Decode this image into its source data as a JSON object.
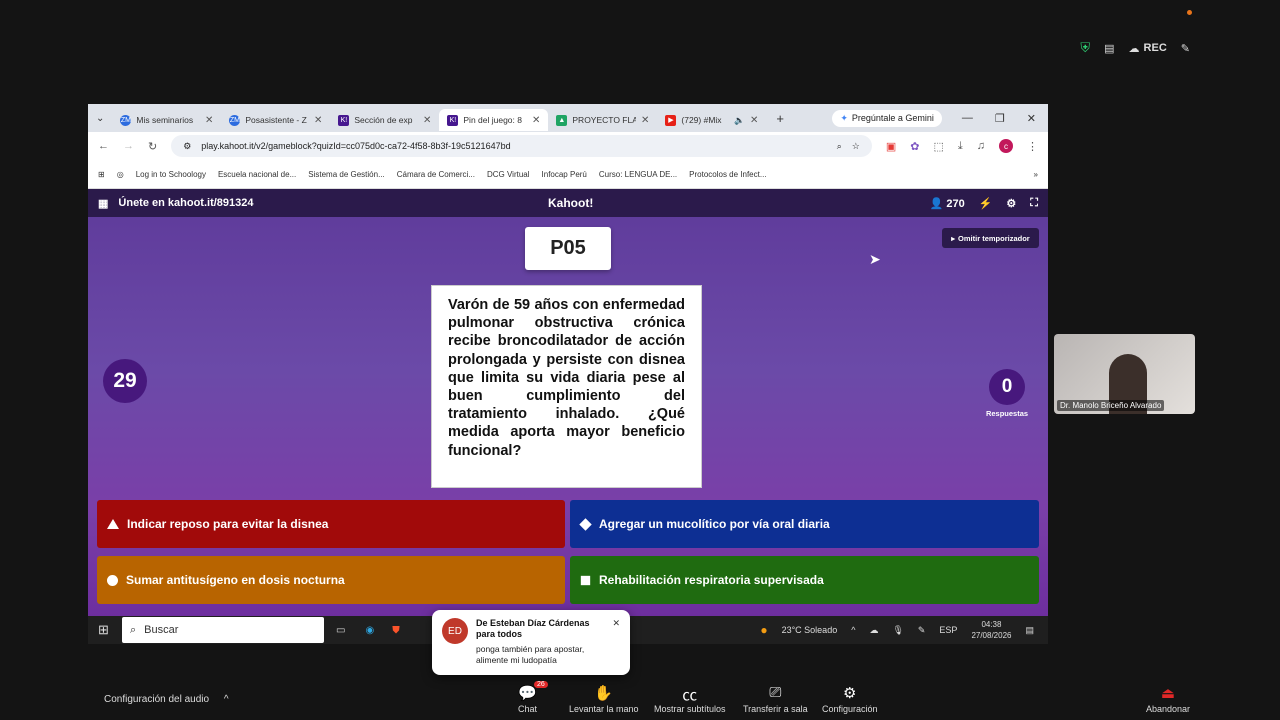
{
  "zoom": {
    "rec_label": "REC",
    "audio_config": "Configuración del audio",
    "footer": {
      "chat": "Chat",
      "chat_badge": "26",
      "raise_hand": "Levantar la mano",
      "captions": "Mostrar subtítulos",
      "transfer": "Transferir a sala",
      "settings": "Configuración",
      "leave": "Abandonar"
    },
    "video_name": "Dr. Manolo Briceño Alvarado",
    "chat_popup": {
      "avatar": "ED",
      "from": "De Esteban Díaz Cárdenas para todos",
      "message": "ponga también para apostar, alimente mi ludopatía"
    }
  },
  "browser": {
    "tabs": [
      {
        "title": "Mis seminarios",
        "fav": "ZM",
        "color": "#2d6cdf"
      },
      {
        "title": "Posasistente - Z",
        "fav": "ZM",
        "color": "#2d6cdf"
      },
      {
        "title": "Sección de exp",
        "fav": "K!",
        "color": "#46178f"
      },
      {
        "title": "Pin del juego: 8",
        "fav": "K!",
        "color": "#46178f"
      },
      {
        "title": "PROYECTO FLA",
        "fav": "▲",
        "color": "#1fa463"
      },
      {
        "title": "(729) #Mix",
        "fav": "▶",
        "color": "#e62117"
      }
    ],
    "gemini": "Pregúntale a Gemini",
    "url": "play.kahoot.it/v2/gameblock?quizId=cc075d0c-ca72-4f58-8b3f-19c5121647bd",
    "bookmarks": [
      "Log in to Schoology",
      "Escuela nacional de...",
      "Sistema de Gestión...",
      "Cámara de Comerci...",
      "DCG Virtual",
      "Infocap Perú",
      "Curso: LENGUA DE...",
      "Protocolos de Infect..."
    ]
  },
  "kahoot": {
    "join": "Únete en kahoot.it/891324",
    "logo": "Kahoot!",
    "players": "270",
    "pin_label": "P05",
    "skip": "Omitir temporizador",
    "timer": "29",
    "answers_count": "0",
    "answers_label": "Respuestas",
    "question": "Varón de 59 años con enfermedad pulmonar obstructiva crónica recibe broncodilatador de acción prolongada y persiste con disnea que limita su vida diaria pese al buen cumplimiento del tratamiento inhalado. ¿Qué medida aporta mayor beneficio funcional?",
    "answers": [
      {
        "text": "Indicar reposo para evitar la disnea",
        "color": "#a10a0a"
      },
      {
        "text": "Agregar un mucolítico por vía oral diaria",
        "color": "#0d2f93"
      },
      {
        "text": "Sumar antitusígeno en dosis nocturna",
        "color": "#b86400"
      },
      {
        "text": "Rehabilitación respiratoria supervisada",
        "color": "#1f6b10"
      }
    ]
  },
  "taskbar": {
    "search": "Buscar",
    "weather": "23°C  Soleado",
    "lang": "ESP",
    "time": "04:38",
    "date": "27/08/2026"
  }
}
